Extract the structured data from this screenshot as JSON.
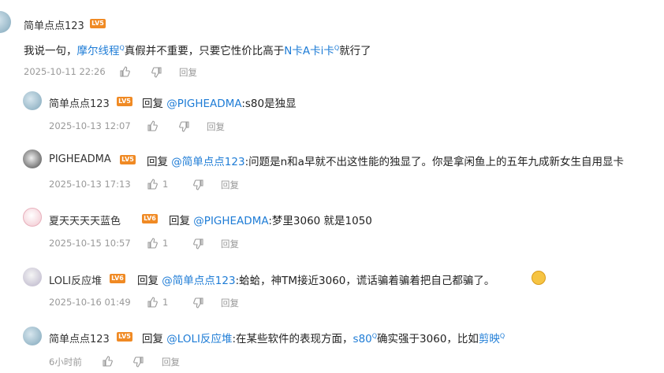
{
  "top": {
    "username": "简单点点123",
    "level": "LV5",
    "content": {
      "p1": "我说一句，",
      "link1": "摩尔线程",
      "p2": "真假并不重要，只要它性价比高于",
      "link2": "N卡A卡i卡",
      "p3": "就行了"
    },
    "time": "2025-10-11 22:26",
    "reply_label": "回复"
  },
  "replies": [
    {
      "username": "简单点点123",
      "level": "LV5",
      "reply_word": "回复",
      "mention": "@PIGHEADMA",
      "text": ":s80是独显",
      "time": "2025-10-13 12:07",
      "likes": "",
      "reply_label": "回复"
    },
    {
      "username": "PIGHEADMA",
      "level": "LV5",
      "reply_word": "回复",
      "mention": "@简单点点123",
      "text": ":问题是n和a早就不出这性能的独显了。你是拿闲鱼上的五年九成新女生自用显卡",
      "time": "2025-10-13 17:13",
      "likes": "1",
      "reply_label": "回复"
    },
    {
      "username": "夏天天天天蓝色",
      "level": "LV6",
      "reply_word": "回复",
      "mention": "@PIGHEADMA",
      "text": ":梦里3060 就是1050",
      "time": "2025-10-15 10:57",
      "likes": "1",
      "reply_label": "回复"
    },
    {
      "username": "LOLI反应堆",
      "level": "LV6",
      "reply_word": "回复",
      "mention": "@简单点点123",
      "text": ":蛤蛤，神TM接近3060，谎话骗着骗着把自己都骗了。",
      "time": "2025-10-16 01:49",
      "likes": "1",
      "reply_label": "回复"
    },
    {
      "username": "简单点点123",
      "level": "LV5",
      "reply_word": "回复",
      "mention": "@LOLI反应堆",
      "text_a": ":在某些软件的表现方面，",
      "link_a": "s80",
      "text_b": "确实强于3060，比如",
      "link_b": "剪映",
      "time": "6小时前",
      "likes": "",
      "reply_label": "回复"
    }
  ],
  "colors": {
    "link": "#1e7cd6",
    "meta": "#999999",
    "level": "#f08a24"
  }
}
